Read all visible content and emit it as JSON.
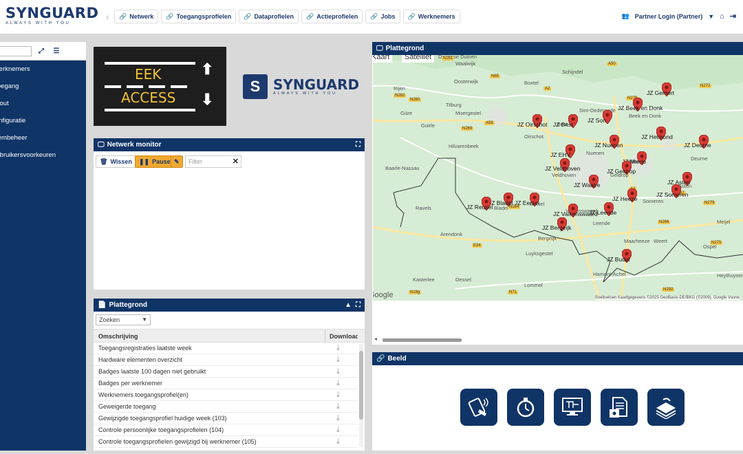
{
  "brand": {
    "name": "SYNGUARD",
    "tagline": "ALWAYS WITH YOU"
  },
  "nav": {
    "tabs": [
      "Netwerk",
      "Toegangsprofielen",
      "Dataprofielen",
      "Actieprofielen",
      "Jobs",
      "Werknemers"
    ],
    "user": "Partner Login (Partner)"
  },
  "sidebar": {
    "items": [
      "Werknemers",
      "Toegang",
      "Lay-out",
      "Configuratie",
      "Systeembeheer",
      "Gebruikersvoorkeuren"
    ]
  },
  "eek": {
    "line1": "EEK",
    "line2": "ACCESS"
  },
  "network_monitor": {
    "title": "Netwerk monitor",
    "clear_label": "Wissen",
    "pause_label": "Pause",
    "filter_placeholder": "Filter"
  },
  "reports": {
    "title": "Plattegrond",
    "search_label": "Zoeken",
    "col_description": "Omschrijving",
    "col_download": "Download",
    "rows": [
      "Toegangsregistraties laatste week",
      "Hardware elementen overzicht",
      "Badges laatste 100 dagen niet gebruikt",
      "Badges per werknemer",
      "Werknemers toegangsprofiel(en)",
      "Geweigerde toegang",
      "Gewijzigde toegangsprofiel huidige week (103)",
      "Controle persoonlijke toegangsprofielen (104)",
      "Controle toegangsprofielen gewijzigd bij werknemer (105)"
    ]
  },
  "map": {
    "title": "Plattegrond",
    "type_kaart": "Kaart",
    "type_satelliet": "Satelliet",
    "attribution": "Sneltoetsen   Kaartgegevens ©2025 GeoBasis-DE/BKG (©2009), Google   Voorw.",
    "google": "Google",
    "cities": [
      "Dunense Duinen",
      "Waalwijk",
      "Boxtel",
      "Schijndel",
      "Rijen",
      "Oosterwijk",
      "Gilze",
      "Tilburg",
      "Moergestel",
      "Sint-Oedenrode",
      "Goirle",
      "Oirschot",
      "Hilvarenbeek",
      "Baarle-Nassau",
      "Ravels",
      "Arendonk",
      "Bladel",
      "Eersel",
      "Valkenswaard",
      "Leende",
      "Bergeijk",
      "Luyksgestel",
      "Dessel",
      "Kasterlee",
      "Lommel",
      "Hamont-Achel",
      "Maarheeze",
      "Weert",
      "Someren",
      "Deurne",
      "Asten",
      "Mierlo",
      "Geldrop",
      "Nuenen",
      "Veldhoven",
      "Best",
      "Meijel",
      "Ospel",
      "Heythuysen",
      "Beek en Donk"
    ],
    "pins": [
      "JZ Gemert",
      "JZ Beek en Donk",
      "JZ Oirschot",
      "JZ Best",
      "JZ Son",
      "JZ Nuenen",
      "JZ Helmond",
      "JZ Deurne",
      "JZ EHV",
      "JZ Veldhoven",
      "JZ Mierlo",
      "JZ Geldrop",
      "JZ Waalre",
      "JZ Asten",
      "JZ Someren",
      "JZ Heeze",
      "JZ Leende",
      "JZ Valkenswaard",
      "JZ Eersel",
      "JZ Bladel",
      "JZ Reusel",
      "JZ Bergeijk",
      "JZ Budel"
    ],
    "roads": [
      "N261",
      "N65",
      "A50",
      "N279",
      "N272",
      "A58",
      "N269",
      "N282",
      "N260",
      "A2",
      "A67",
      "N284",
      "N266",
      "N275",
      "A2",
      "N279",
      "E34",
      "N19g",
      "N71",
      "N292"
    ]
  },
  "beeld": {
    "title": "Beeld",
    "tiles": [
      "badge-reader-icon",
      "stopwatch-icon",
      "floorplan-monitor-icon",
      "document-safe-icon",
      "money-stack-icon"
    ]
  },
  "colors": {
    "navy": "#0f3466",
    "pin": "#d83a34",
    "pause": "#f0a830"
  }
}
